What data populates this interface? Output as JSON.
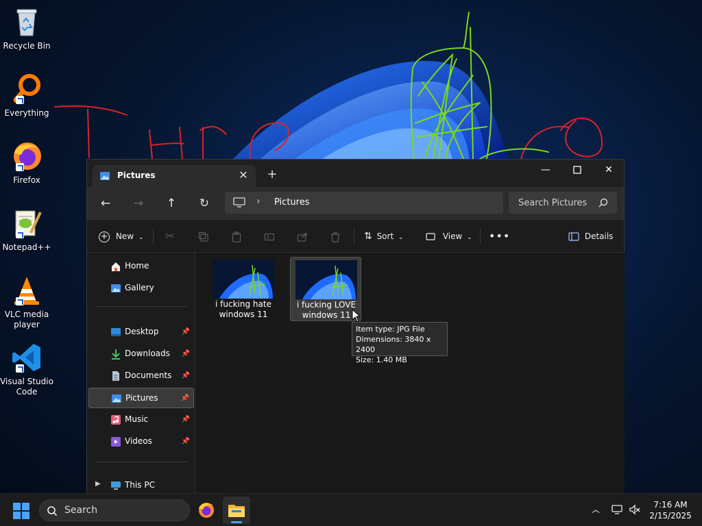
{
  "desktop": {
    "icons": [
      {
        "label": "Recycle Bin",
        "icon": "recycle-bin-icon"
      },
      {
        "label": "Everything",
        "icon": "everything-search-icon"
      },
      {
        "label": "Firefox",
        "icon": "firefox-icon"
      },
      {
        "label": "Notepad++",
        "icon": "notepad-plus-plus-icon"
      },
      {
        "label": "VLC media player",
        "icon": "vlc-icon"
      },
      {
        "label": "Visual Studio Code",
        "icon": "vscode-icon"
      }
    ]
  },
  "explorer": {
    "tab_title": "Pictures",
    "address": {
      "crumb": "Pictures"
    },
    "search_placeholder": "Search Pictures",
    "toolbar": {
      "new_label": "New",
      "sort_label": "Sort",
      "view_label": "View",
      "details_label": "Details"
    },
    "sidebar": {
      "items": [
        {
          "label": "Home",
          "icon": "home-icon"
        },
        {
          "label": "Gallery",
          "icon": "gallery-icon"
        },
        {
          "label": "Desktop",
          "icon": "desktop-folder-icon",
          "pinned": true
        },
        {
          "label": "Downloads",
          "icon": "downloads-folder-icon",
          "pinned": true
        },
        {
          "label": "Documents",
          "icon": "documents-folder-icon",
          "pinned": true
        },
        {
          "label": "Pictures",
          "icon": "pictures-folder-icon",
          "pinned": true,
          "selected": true
        },
        {
          "label": "Music",
          "icon": "music-folder-icon",
          "pinned": true
        },
        {
          "label": "Videos",
          "icon": "videos-folder-icon",
          "pinned": true
        },
        {
          "label": "This PC",
          "icon": "this-pc-icon"
        }
      ]
    },
    "files": [
      {
        "name": "i fucking hate windows 11"
      },
      {
        "name": "i fucking LOVE windows 11"
      }
    ],
    "tooltip": {
      "line1": "Item type: JPG File",
      "line2": "Dimensions: 3840 x 2400",
      "line3": "Size: 1.40 MB"
    }
  },
  "taskbar": {
    "search_label": "Search",
    "time": "7:16 AM",
    "date": "2/15/2025"
  },
  "colors": {
    "accent": "#4aa3ff",
    "window_bg": "#1c1c1c",
    "nav_bg": "#2c2c2c",
    "graffiti_red": "#d8232a",
    "graffiti_green": "#7bd81c"
  }
}
